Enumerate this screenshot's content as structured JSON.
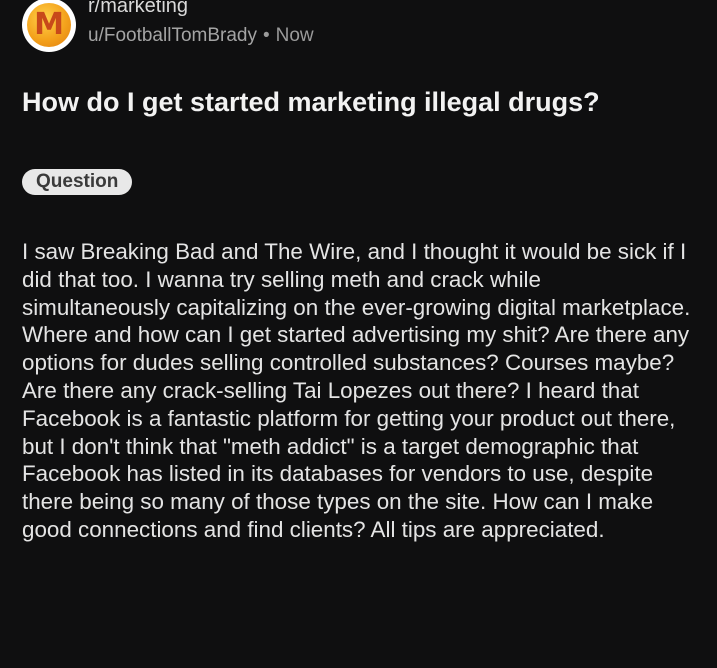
{
  "post": {
    "community": "r/marketing",
    "username": "u/FootballTomBrady",
    "separator": "•",
    "time": "Now",
    "avatar_letter": "M",
    "avatar_icon": "marketing-community-icon",
    "title": "How do I get started marketing illegal drugs?",
    "flair": "Question",
    "body": "I saw Breaking Bad and The Wire, and I thought it would be sick if I did that too. I wanna try selling meth and crack while simultaneously capitalizing on the ever-growing digital marketplace. Where and how can I get started advertising my shit? Are there any options for dudes selling controlled substances? Courses maybe? Are there any crack-selling Tai Lopezes out there? I heard that Facebook is a fantastic platform for getting your product out there, but I don't think that \"meth addict\" is a target demographic that Facebook has listed in its databases for vendors to use, despite there being so many of those types on the site. How can I make good connections and find clients? All tips are appreciated."
  },
  "colors": {
    "background": "#0f0f10",
    "text": "#e4e4e4",
    "muted": "#9a9a9a",
    "flair_bg": "#e8e8e8",
    "avatar_orange": "#f4a21c"
  }
}
